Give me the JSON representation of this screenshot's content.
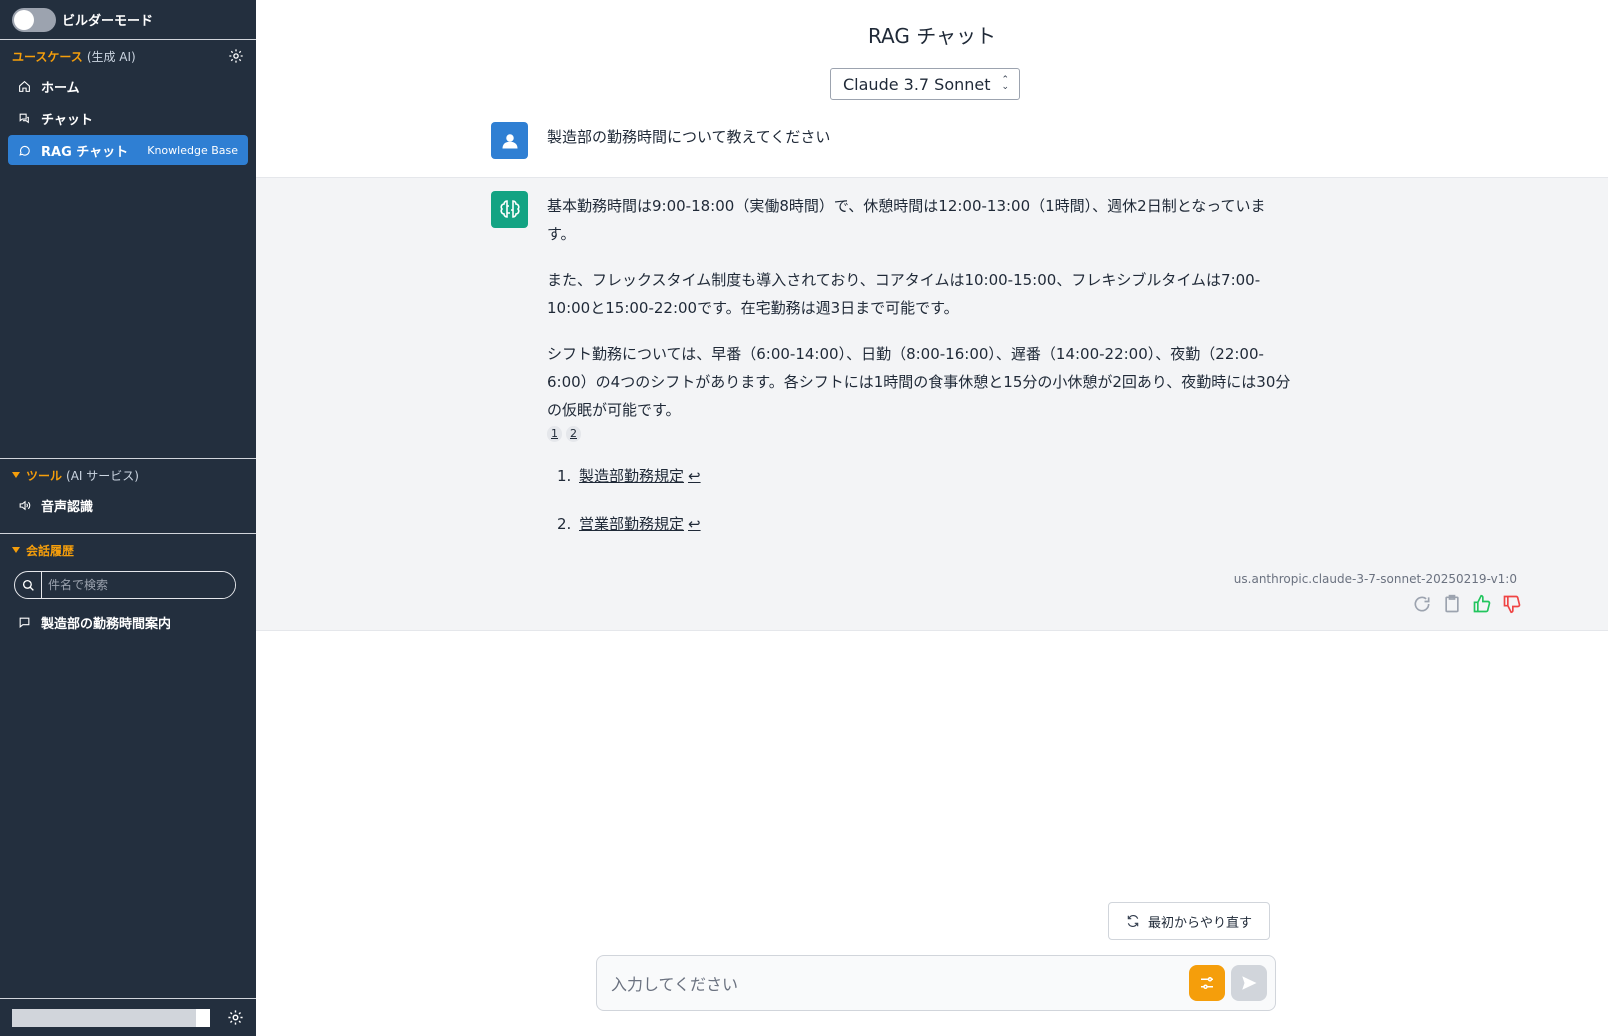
{
  "sidebar": {
    "builder_mode_label": "ビルダーモード",
    "usecase_title": "ユースケース",
    "usecase_sub": "(生成 AI)",
    "nav": [
      {
        "label": "ホーム"
      },
      {
        "label": "チャット"
      },
      {
        "label": "RAG チャット",
        "badge": "Knowledge Base"
      }
    ],
    "tools_title": "ツール",
    "tools_sub": "(AI サービス)",
    "tools": [
      {
        "label": "音声認識"
      }
    ],
    "history_title": "会話履歴",
    "history_search_placeholder": "件名で検索",
    "history_items": [
      {
        "label": "製造部の勤務時間案内"
      }
    ]
  },
  "main": {
    "title": "RAG チャット",
    "model_selected": "Claude 3.7 Sonnet",
    "user_message": "製造部の勤務時間について教えてください",
    "ai_paragraphs": [
      "基本勤務時間は9:00-18:00（実働8時間）で、休憩時間は12:00-13:00（1時間）、週休2日制となっています。",
      "また、フレックスタイム制度も導入されており、コアタイムは10:00-15:00、フレキシブルタイムは7:00-10:00と15:00-22:00です。在宅勤務は週3日まで可能です。",
      "シフト勤務については、早番（6:00-14:00）、日勤（8:00-16:00）、遅番（14:00-22:00）、夜勤（22:00-6:00）の4つのシフトがあります。各シフトには1時間の食事休憩と15分の小休憩が2回あり、夜勤時には30分の仮眠が可能です。"
    ],
    "citations": [
      "1",
      "2"
    ],
    "references": [
      {
        "num": "1.",
        "label": "製造部勤務規定",
        "back": "↩"
      },
      {
        "num": "2.",
        "label": "営業部勤務規定",
        "back": "↩"
      }
    ],
    "model_id": "us.anthropic.claude-3-7-sonnet-20250219-v1:0",
    "reset_label": "最初からやり直す",
    "input_placeholder": "入力してください"
  },
  "colors": {
    "sidebar_bg": "#232f3e",
    "accent_orange": "#f59e0b",
    "active_blue": "#2f7fd3",
    "ai_green": "#13a383"
  }
}
